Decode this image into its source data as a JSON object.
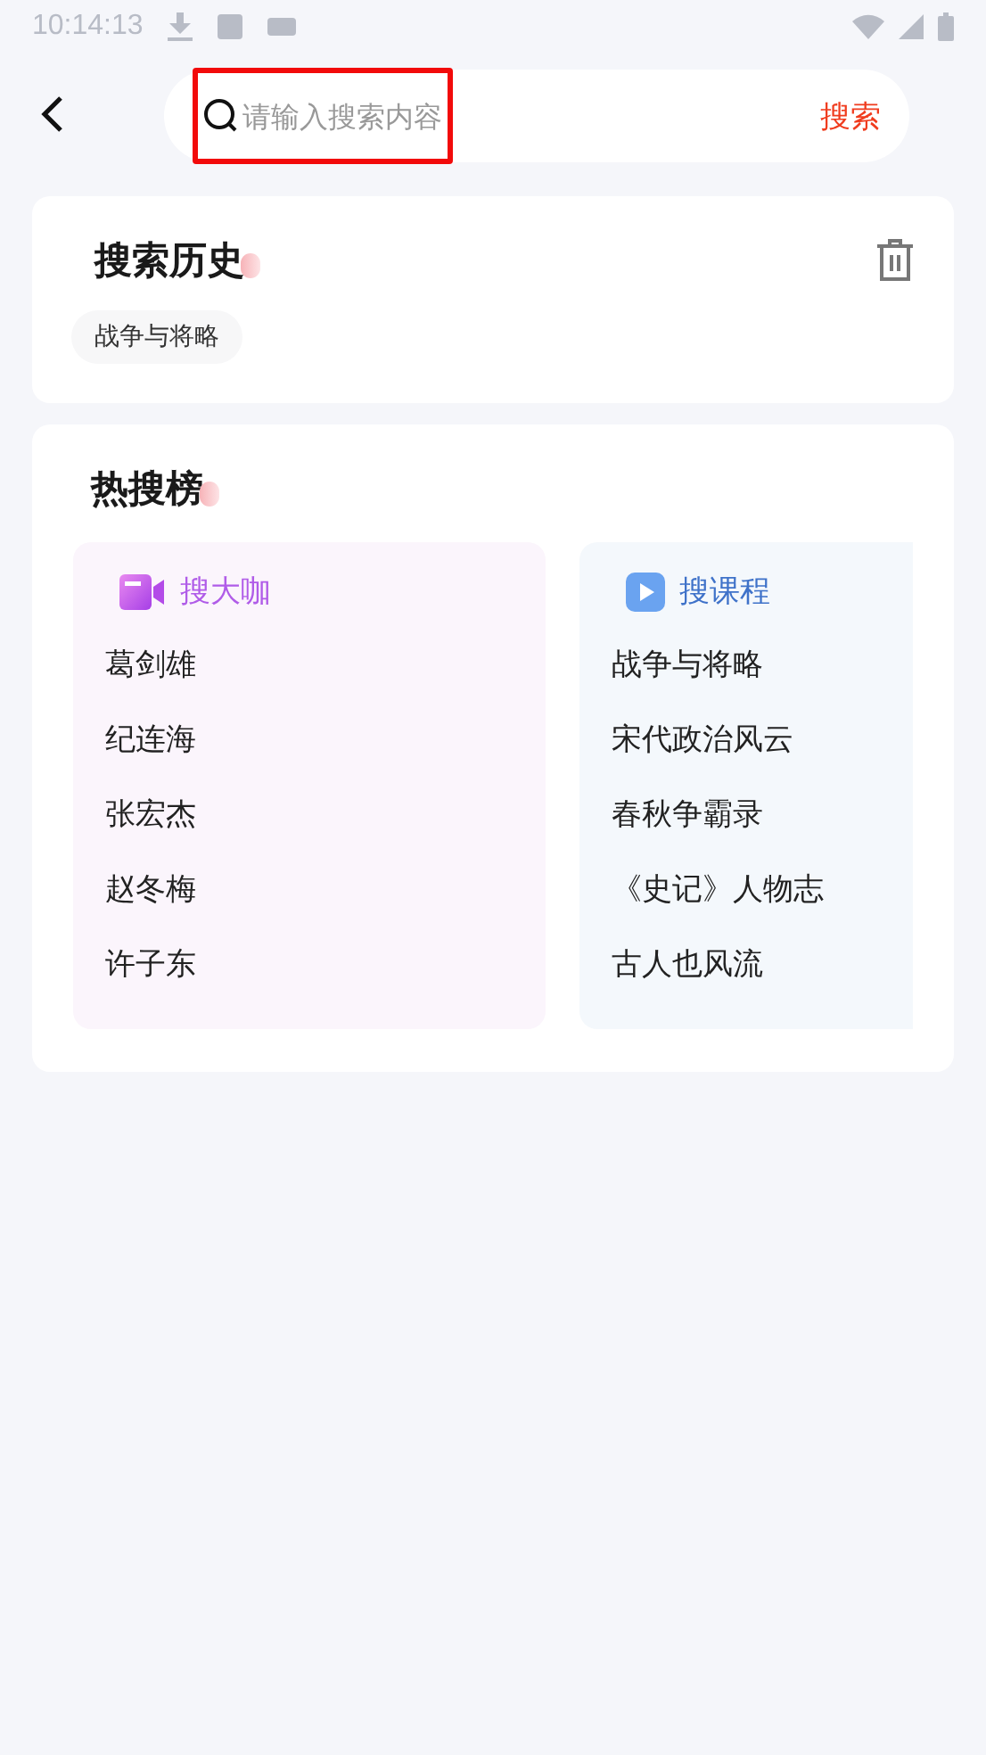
{
  "status_bar": {
    "time": "10:14:13"
  },
  "search": {
    "placeholder": "请输入搜索内容",
    "button": "搜索",
    "highlighted": true
  },
  "history": {
    "title": "搜索历史",
    "tags": [
      "战争与将略"
    ]
  },
  "hot": {
    "title": "热搜榜",
    "lists": [
      {
        "kind": "people",
        "title": "搜大咖",
        "items": [
          "葛剑雄",
          "纪连海",
          "张宏杰",
          "赵冬梅",
          "许子东"
        ]
      },
      {
        "kind": "courses",
        "title": "搜课程",
        "items": [
          "战争与将略",
          "宋代政治风云",
          "春秋争霸录",
          "《史记》人物志",
          "古人也风流"
        ]
      }
    ]
  }
}
